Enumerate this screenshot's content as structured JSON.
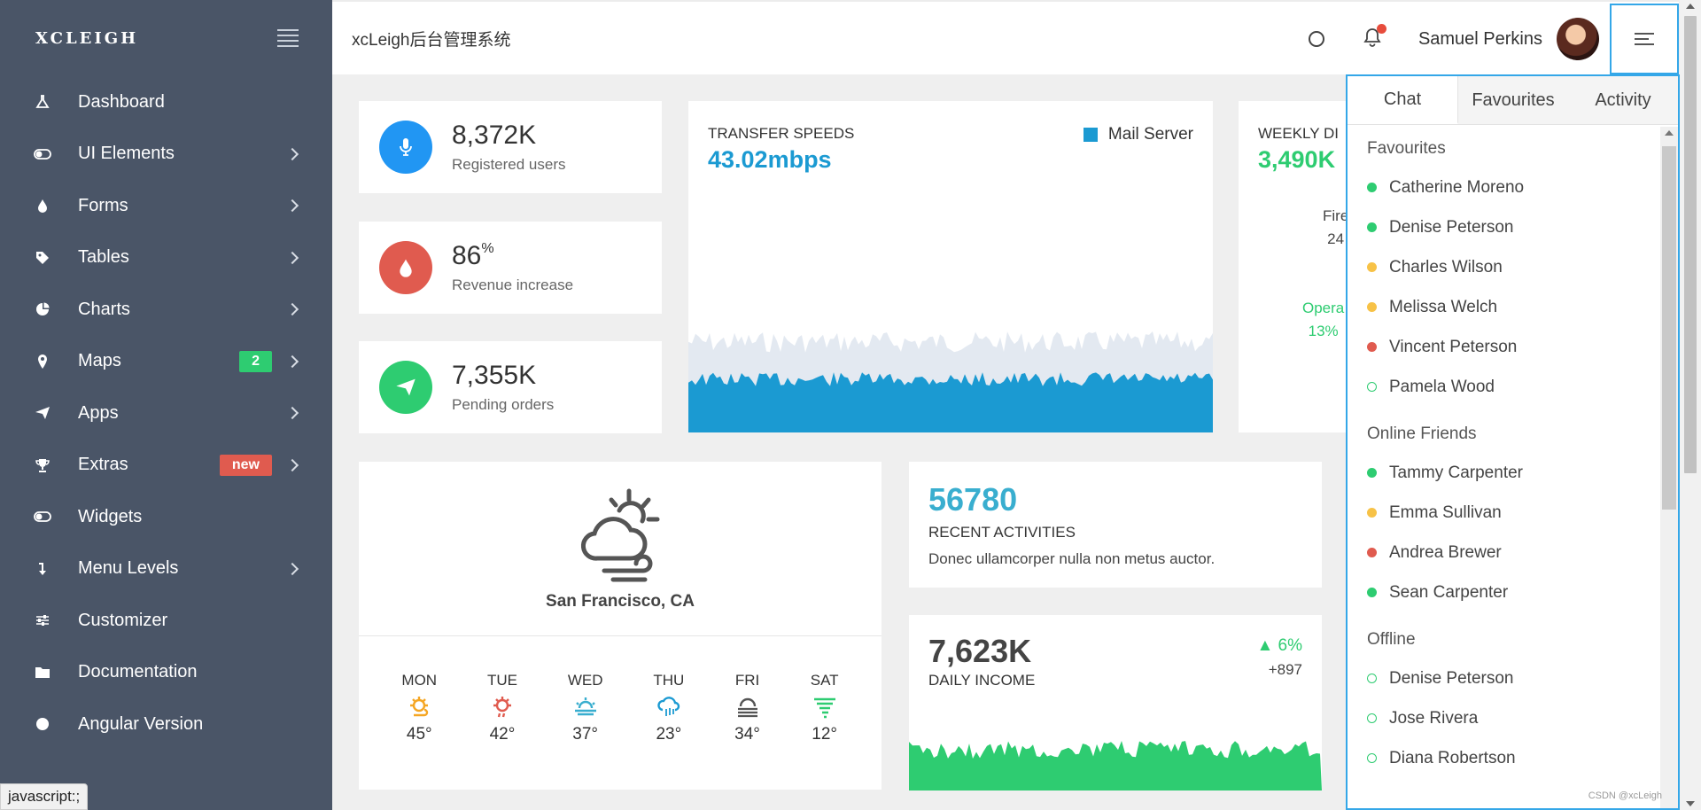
{
  "sidebar": {
    "brand": "XCLEIGH",
    "items": [
      {
        "label": "Dashboard",
        "icon": "flask-icon",
        "chevron": false,
        "badge": ""
      },
      {
        "label": "UI Elements",
        "icon": "toggle-icon",
        "chevron": true,
        "badge": ""
      },
      {
        "label": "Forms",
        "icon": "drop-icon",
        "chevron": true,
        "badge": ""
      },
      {
        "label": "Tables",
        "icon": "tag-icon",
        "chevron": true,
        "badge": ""
      },
      {
        "label": "Charts",
        "icon": "pie-chart-icon",
        "chevron": true,
        "badge": ""
      },
      {
        "label": "Maps",
        "icon": "map-pin-icon",
        "chevron": true,
        "badge": "2"
      },
      {
        "label": "Apps",
        "icon": "paper-plane-icon",
        "chevron": true,
        "badge": ""
      },
      {
        "label": "Extras",
        "icon": "trophy-icon",
        "chevron": true,
        "badge": "new"
      },
      {
        "label": "Widgets",
        "icon": "toggle-icon",
        "chevron": false,
        "badge": ""
      },
      {
        "label": "Menu Levels",
        "icon": "level-down-icon",
        "chevron": true,
        "badge": ""
      },
      {
        "label": "Customizer",
        "icon": "sliders-icon",
        "chevron": false,
        "badge": ""
      },
      {
        "label": "Documentation",
        "icon": "folder-icon",
        "chevron": false,
        "badge": ""
      },
      {
        "label": "Angular Version",
        "icon": "circle-icon",
        "chevron": false,
        "badge": ""
      }
    ]
  },
  "header": {
    "title": "xcLeigh后台管理系统",
    "user_name": "Samuel Perkins"
  },
  "stats": [
    {
      "value": "8,372K",
      "suffix": "",
      "label": "Registered users",
      "color": "#2196f3",
      "icon": "microphone-icon"
    },
    {
      "value": "86",
      "suffix": "%",
      "label": "Revenue increase",
      "color": "#e05b4f",
      "icon": "drop-icon"
    },
    {
      "value": "7,355K",
      "suffix": "",
      "label": "Pending orders",
      "color": "#2ecc71",
      "icon": "paper-plane-icon"
    }
  ],
  "transfer": {
    "title": "TRANSFER SPEEDS",
    "value": "43.02mbps",
    "legend": "Mail Server"
  },
  "weekly": {
    "title": "WEEKLY DI",
    "value": "3,490K",
    "fire_label": "Fire",
    "fire_value": "24",
    "opera_label": "Opera",
    "opera_value": "13%"
  },
  "weather": {
    "city": "San Francisco, CA",
    "days": [
      {
        "day": "MON",
        "temp": "45°",
        "icon": "sun-cloud-icon",
        "color": "#f5a623"
      },
      {
        "day": "TUE",
        "temp": "42°",
        "icon": "sun-rain-icon",
        "color": "#e05b4f"
      },
      {
        "day": "WED",
        "temp": "37°",
        "icon": "sun-fog-icon",
        "color": "#39aecf"
      },
      {
        "day": "THU",
        "temp": "23°",
        "icon": "cloud-rain-icon",
        "color": "#1b9ad2"
      },
      {
        "day": "FRI",
        "temp": "34°",
        "icon": "fog-icon",
        "color": "#555555"
      },
      {
        "day": "SAT",
        "temp": "12°",
        "icon": "tornado-icon",
        "color": "#2ecc71"
      }
    ]
  },
  "activities": {
    "value": "56780",
    "title": "RECENT ACTIVITIES",
    "text": "Donec ullamcorper nulla non metus auctor."
  },
  "income": {
    "value": "7,623K",
    "title": "DAILY INCOME",
    "change": "6%",
    "delta": "+897"
  },
  "panel": {
    "tabs": [
      "Chat",
      "Favourites",
      "Activity"
    ],
    "groups": [
      {
        "title": "Favourites",
        "contacts": [
          {
            "name": "Catherine Moreno",
            "status": "online"
          },
          {
            "name": "Denise Peterson",
            "status": "online"
          },
          {
            "name": "Charles Wilson",
            "status": "away"
          },
          {
            "name": "Melissa Welch",
            "status": "away"
          },
          {
            "name": "Vincent Peterson",
            "status": "busy"
          },
          {
            "name": "Pamela Wood",
            "status": "offline"
          }
        ]
      },
      {
        "title": "Online Friends",
        "contacts": [
          {
            "name": "Tammy Carpenter",
            "status": "online"
          },
          {
            "name": "Emma Sullivan",
            "status": "away"
          },
          {
            "name": "Andrea Brewer",
            "status": "busy"
          },
          {
            "name": "Sean Carpenter",
            "status": "online"
          }
        ]
      },
      {
        "title": "Offline",
        "contacts": [
          {
            "name": "Denise Peterson",
            "status": "offline"
          },
          {
            "name": "Jose Rivera",
            "status": "offline"
          },
          {
            "name": "Diana Robertson",
            "status": "offline"
          }
        ]
      }
    ]
  },
  "status_tip": "javascript:;",
  "watermark": "CSDN @xcLeigh",
  "colors": {
    "sidebar": "#4a5567",
    "accent_blue": "#1b9ad2",
    "green": "#2ecc71",
    "panel_border": "#34a7e8"
  }
}
